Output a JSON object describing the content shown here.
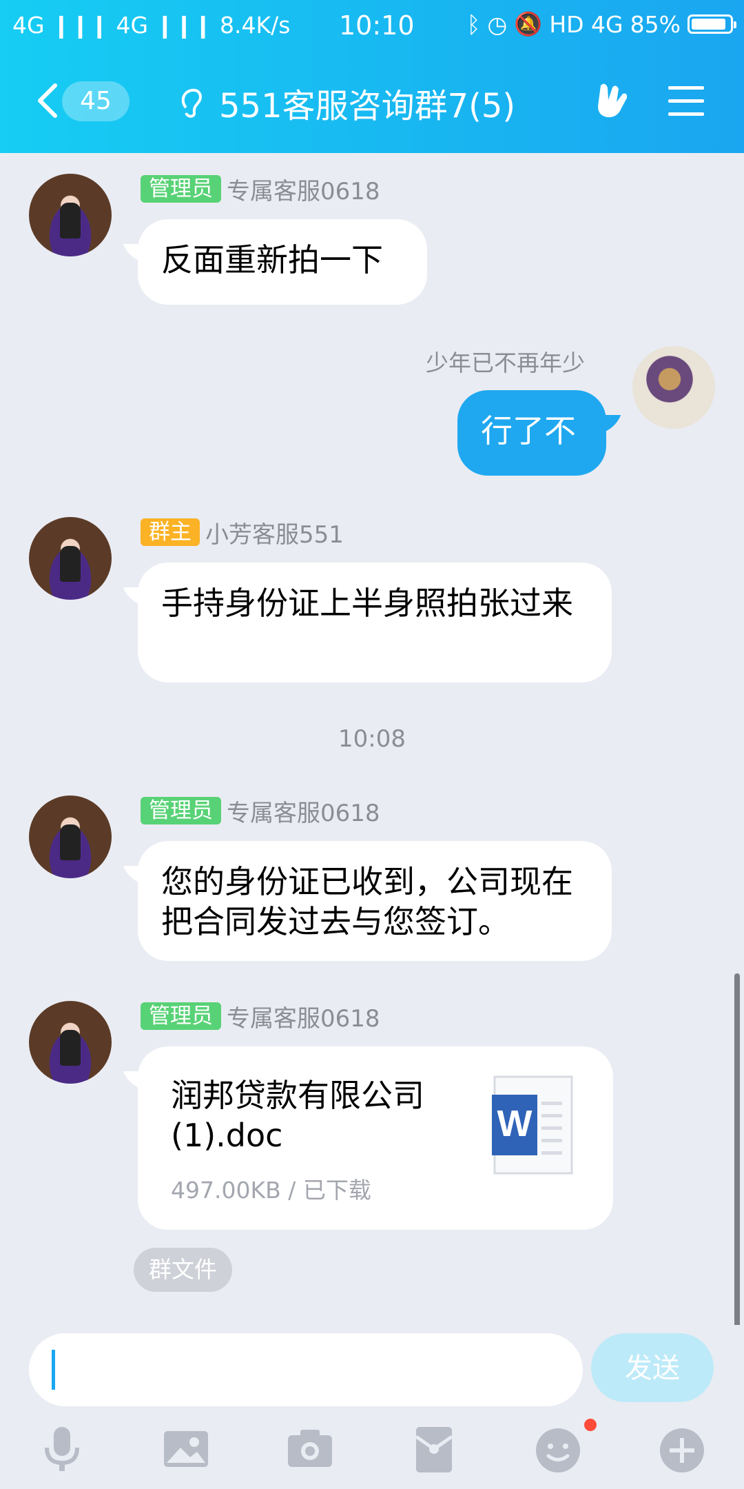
{
  "status_bar": {
    "left": "4G ❙❙❙ 4G ❙❙❙ 8.4K/s",
    "time": "10:10",
    "right_text": "HD 4G",
    "battery": "85%"
  },
  "header": {
    "back_count": "45",
    "title": "551客服咨询群7(5)"
  },
  "messages": [
    {
      "tag": "管理员",
      "sender": "专属客服0618",
      "text": "反面重新拍一下"
    },
    {
      "sender": "少年已不再年少",
      "text": "行了不"
    },
    {
      "tag": "群主",
      "sender": "小芳客服551",
      "text": "手持身份证上半身照拍张过来"
    },
    {
      "tag": "管理员",
      "sender": "专属客服0618",
      "text": "您的身份证已收到，公司现在把合同发过去与您签订。"
    },
    {
      "tag": "管理员",
      "sender": "专属客服0618"
    }
  ],
  "time_separator": "10:08",
  "file": {
    "name": "润邦贷款有限公司(1).doc",
    "meta": "497.00KB / 已下载",
    "tag": "群文件"
  },
  "input": {
    "value": "",
    "send_label": "发送"
  },
  "toolbar_icons": [
    "mic-icon",
    "image-icon",
    "camera-icon",
    "red-packet-icon",
    "emoji-icon",
    "plus-icon"
  ],
  "colors": {
    "header_start": "#16cdf3",
    "header_end": "#1aa6f0",
    "my_bubble": "#1fa8f0",
    "admin_tag": "#58d276",
    "owner_tag": "#fbb225"
  }
}
